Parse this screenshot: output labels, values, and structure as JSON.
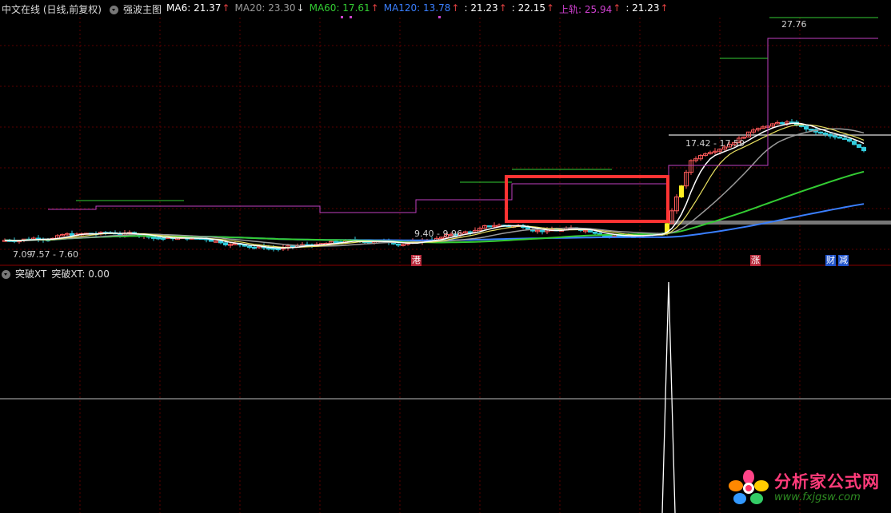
{
  "header": {
    "title": "中文在线 (日线,前复权)",
    "indicator_name": "强波主图",
    "items": [
      {
        "label": "MA6: 21.37",
        "color": "#ffffff",
        "arrow": "up"
      },
      {
        "label": "MA20: 23.30",
        "color": "#9a9a9a",
        "arrow": "down"
      },
      {
        "label": "MA60: 17.61",
        "color": "#33cc33",
        "arrow": "up"
      },
      {
        "label": "MA120: 13.78",
        "color": "#3a7fff",
        "arrow": "up"
      },
      {
        "label": ": 21.23",
        "color": "#ffffff",
        "arrow": "up"
      },
      {
        "label": ": 22.15",
        "color": "#ffffff",
        "arrow": "up"
      },
      {
        "label": "上轨: 25.94",
        "color": "#d040d0",
        "arrow": "up"
      },
      {
        "label": ": 21.23",
        "color": "#ffffff",
        "arrow": "up"
      }
    ],
    "arrow_up": "↑",
    "arrow_down": "↓"
  },
  "price_labels": {
    "high": "27.76",
    "zone_recent": "17.42 - 17.59",
    "zone_mid": "9.40 - 9.96",
    "zone_low": "7.57 - 7.60",
    "low_value": "7.09"
  },
  "event_tags": [
    {
      "text": "港",
      "color": "#b8283a"
    },
    {
      "text": "涨",
      "color": "#b8283a"
    },
    {
      "text": "财",
      "color": "#2255cc"
    },
    {
      "text": "减",
      "color": "#2255cc"
    }
  ],
  "sub_panel": {
    "indicator_name": "突破XT",
    "value_label": "突破XT: 0.00"
  },
  "colors": {
    "up_candle": "#ff5a5a",
    "down_candle": "#33ccdd",
    "yellow_candle": "#ffee22",
    "ma6": "#ffffff",
    "ma20": "#9a9a9a",
    "ma60": "#33cc33",
    "ma120": "#3a7fff",
    "upper_band": "#c040c0",
    "highlight_box": "#ff3333",
    "grid": "#5a0000"
  },
  "watermark": {
    "title": "分析家公式网",
    "url": "www.fxjgsw.com",
    "icon": "flower-logo-icon"
  },
  "chart_data": [
    {
      "type": "candlestick",
      "title": "中文在线 (日线,前复权)",
      "approx_range": [
        7.09,
        27.76
      ],
      "series": [
        {
          "name": "MA6",
          "last": 21.37
        },
        {
          "name": "MA20",
          "last": 23.3
        },
        {
          "name": "MA60",
          "last": 17.61
        },
        {
          "name": "MA120",
          "last": 13.78
        },
        {
          "name": "上轨",
          "last": 25.94
        }
      ]
    },
    {
      "type": "line",
      "title": "突破XT",
      "values_note": "single spike from 0 to 1, otherwise 0.00",
      "last": 0.0
    }
  ]
}
